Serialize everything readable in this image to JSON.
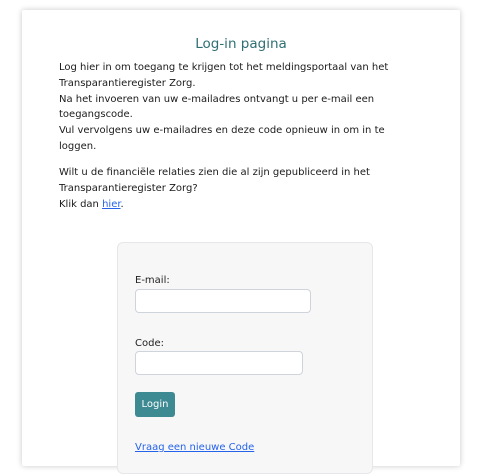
{
  "page": {
    "title": "Log-in pagina",
    "intro_lines": [
      "Log hier in om toegang te krijgen tot het meldingsportaal van het",
      "Transparantieregister Zorg.",
      "Na het invoeren van uw e-mailadres ontvangt u per e-mail een",
      "toegangscode.",
      "Vul vervolgens uw e-mailadres en deze code opnieuw in om in te",
      "loggen."
    ],
    "published_lines": [
      "Wilt u de financiële relaties zien die al zijn gepubliceerd in het",
      "Transparantieregister Zorg?"
    ],
    "click_prefix": "Klik dan ",
    "click_link": "hier",
    "click_suffix": "."
  },
  "form": {
    "email_label": "E-mail:",
    "email_value": "",
    "code_label": "Code:",
    "code_value": "",
    "login_button": "Login",
    "new_code_link": "Vraag een nieuwe Code"
  },
  "colors": {
    "title": "#2f6f73",
    "button": "#3d8a92",
    "link": "#2563eb"
  }
}
